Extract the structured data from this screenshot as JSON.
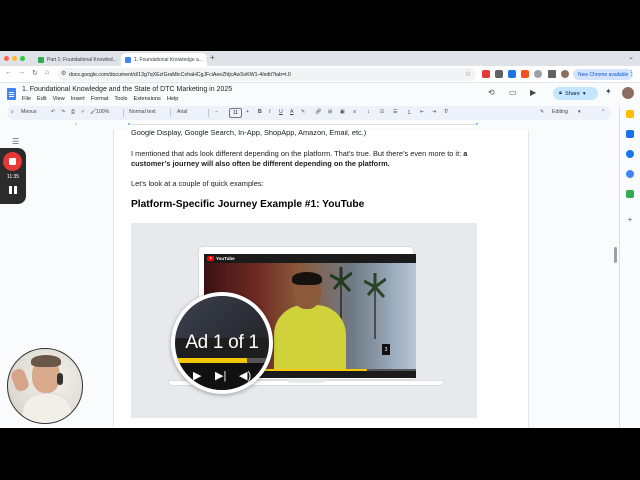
{
  "browser": {
    "tabs": [
      {
        "title": "Part 1: Foundational Knowled...",
        "active": false,
        "favicon_color": "#34a853"
      },
      {
        "title": "1. Foundational Knowledge a...",
        "active": true,
        "favicon_color": "#4285f4"
      }
    ],
    "new_tab_label": "+",
    "url": "docs.google.com/document/d/13g7qXEzIGraMtcCohaHCgJFciAeeZhljcAwSvKW1-4/edit?tab=t.0",
    "new_chrome_label": "New Chrome available",
    "window_controls": {
      "close": "#ff5f57",
      "minimize": "#febc2e",
      "maximize": "#28c840"
    }
  },
  "docs": {
    "title": "1. Foundational Knowledge and the State of DTC Marketing in 2025",
    "menus": [
      "File",
      "Edit",
      "View",
      "Insert",
      "Format",
      "Tools",
      "Extensions",
      "Help"
    ],
    "share_label": "Share",
    "toolbar": {
      "menus_search": "Menus",
      "zoom": "100%",
      "style": "Normal text",
      "font": "Arial",
      "font_size": "11",
      "mode": "Editing"
    }
  },
  "document": {
    "line_top": "Google Display, Google Search, In-App, ShopApp, Amazon, Email, etc.)",
    "para_1_plain": "I mentioned that ads look different depending on the platform. That’s true. But there’s even more to it: ",
    "para_1_bold": "a customer’s journey will also often be different depending on the platform.",
    "para_2": "Let’s look at a couple of quick examples:",
    "heading": "Platform-Specific Journey Example #1: YouTube",
    "embedded_image": {
      "yt_brand": "YouTube",
      "ad_counter": "3",
      "magnifier_text": "Ad 1 of 1",
      "progress": 0.77
    }
  },
  "recorder": {
    "time": "11:35",
    "accent": "#e53935"
  }
}
